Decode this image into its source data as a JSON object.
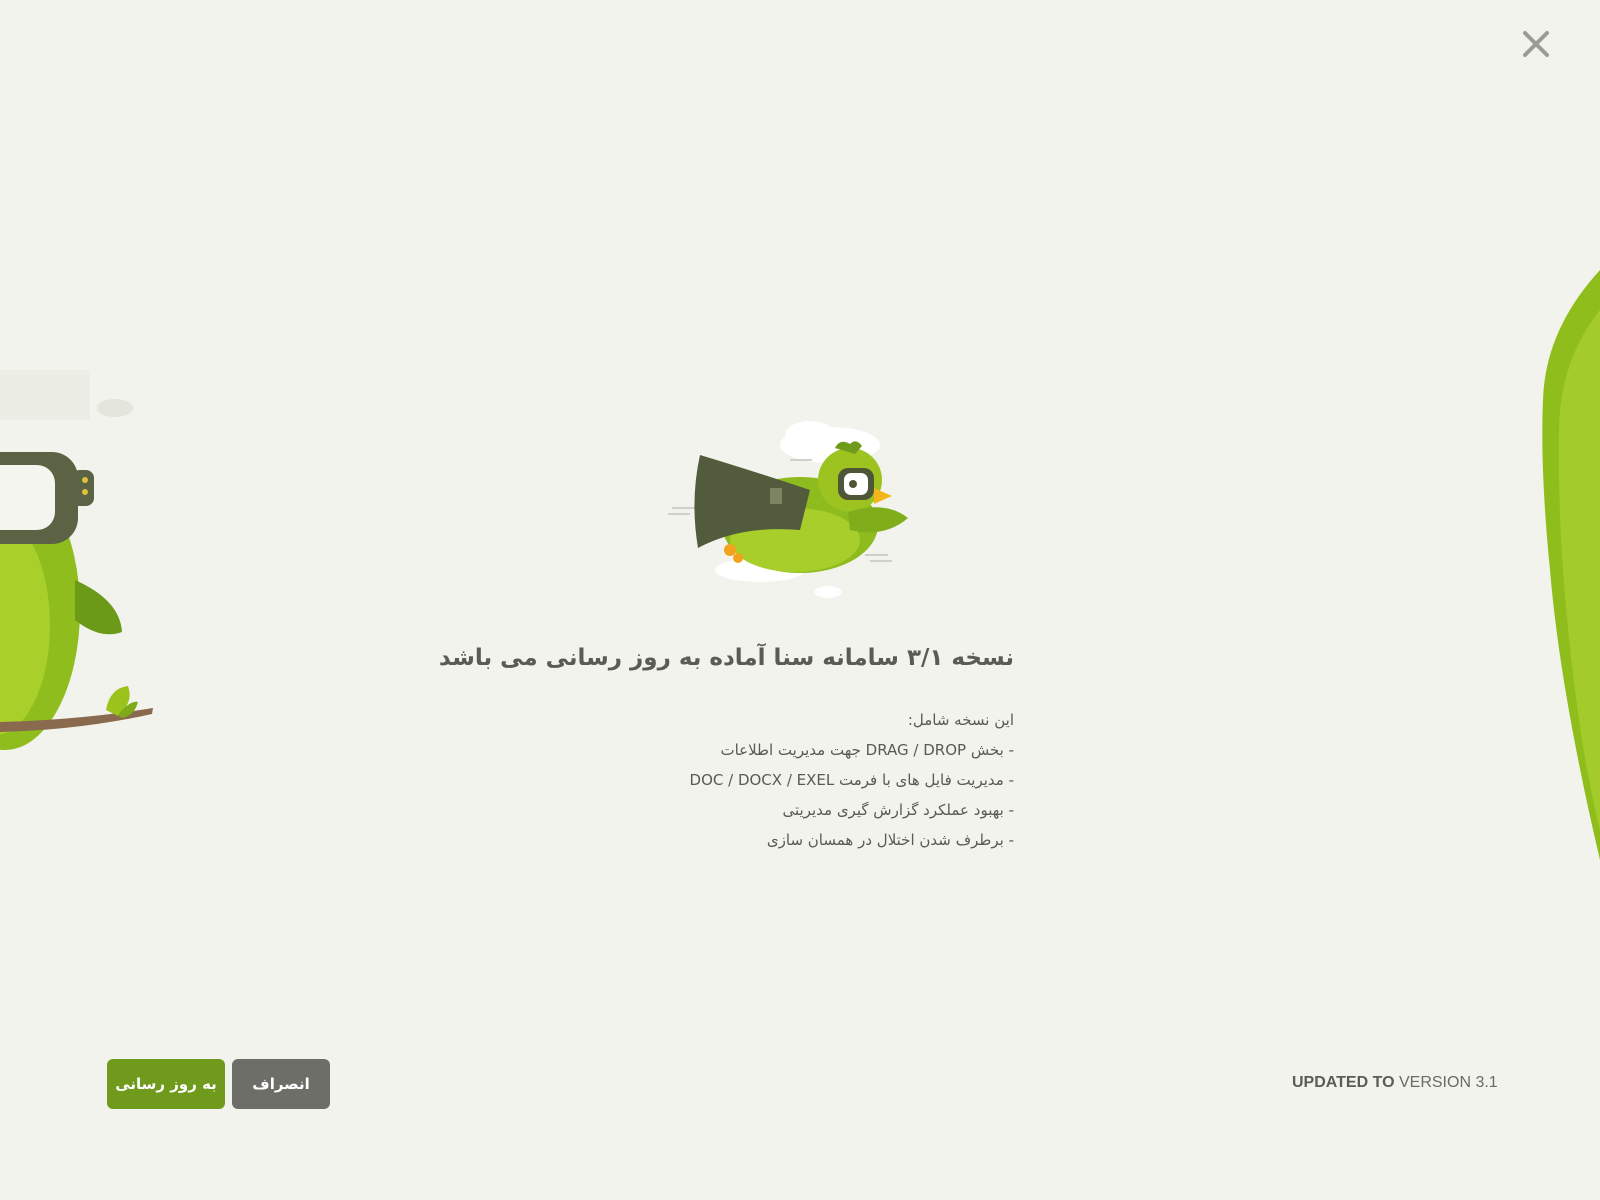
{
  "dialog": {
    "title": "نسخه ۳/۱ سامانه سنا آماده به روز رسانی می باشد",
    "intro": "این نسخه شامل:",
    "features": [
      "- بخش DRAG / DROP جهت مدیریت اطلاعات",
      "- مدیریت فایل های با فرمت DOC / DOCX / EXEL",
      "- بهبود عملکرد گزارش گیری مدیریتی",
      "- برطرف شدن اختلال در همسان سازی"
    ]
  },
  "footer": {
    "version_prefix": "UPDATED TO",
    "version_text": "VERSION 3.1",
    "update_label": "به روز رسانی",
    "cancel_label": "انصراف"
  },
  "icons": {
    "close": "close-icon",
    "hero": "flying-bird-illustration",
    "left_deco": "perched-bird-illustration",
    "right_deco": "green-leaf-illustration"
  },
  "colors": {
    "background": "#f2f3ec",
    "primary": "#6f9a1c",
    "secondary": "#6d6e68",
    "text": "#595a54",
    "leaf": "#9cc21c"
  }
}
